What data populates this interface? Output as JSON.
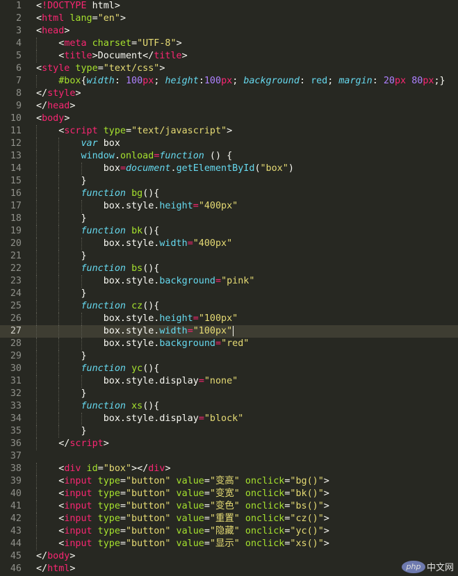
{
  "editor": {
    "active_line": 27,
    "caret_line": 27,
    "theme_colors": {
      "background": "#272822",
      "tag": "#f92672",
      "attribute": "#a6e22e",
      "string": "#e6db74",
      "keyword": "#66d9ef",
      "number": "#ae81ff",
      "text": "#f8f8f2",
      "line_number": "#8f908a"
    },
    "lines": [
      {
        "n": "1",
        "indent": 0,
        "tokens": [
          [
            "plain",
            "<"
          ],
          [
            "tag",
            "!DOCTYPE"
          ],
          [
            "plain",
            " html>"
          ]
        ]
      },
      {
        "n": "2",
        "indent": 0,
        "tokens": [
          [
            "plain",
            "<"
          ],
          [
            "tag",
            "html"
          ],
          [
            "attr",
            " lang"
          ],
          [
            "plain",
            "="
          ],
          [
            "str",
            "\"en\""
          ],
          [
            "plain",
            ">"
          ]
        ]
      },
      {
        "n": "3",
        "indent": 0,
        "tokens": [
          [
            "plain",
            "<"
          ],
          [
            "tag",
            "head"
          ],
          [
            "plain",
            ">"
          ]
        ]
      },
      {
        "n": "4",
        "indent": 1,
        "tokens": [
          [
            "plain",
            "<"
          ],
          [
            "tag",
            "meta"
          ],
          [
            "attr",
            " charset"
          ],
          [
            "plain",
            "="
          ],
          [
            "str",
            "\"UTF-8\""
          ],
          [
            "plain",
            ">"
          ]
        ]
      },
      {
        "n": "5",
        "indent": 1,
        "tokens": [
          [
            "plain",
            "<"
          ],
          [
            "tag",
            "title"
          ],
          [
            "plain",
            ">Document</"
          ],
          [
            "tag",
            "title"
          ],
          [
            "plain",
            ">"
          ]
        ]
      },
      {
        "n": "6",
        "indent": 0,
        "tokens": [
          [
            "plain",
            "<"
          ],
          [
            "tag",
            "style"
          ],
          [
            "attr",
            " type"
          ],
          [
            "plain",
            "="
          ],
          [
            "str",
            "\"text/css\""
          ],
          [
            "plain",
            ">"
          ]
        ]
      },
      {
        "n": "7",
        "indent": 1,
        "tokens": [
          [
            "attr",
            "#box"
          ],
          [
            "plain",
            "{"
          ],
          [
            "cssprop",
            "width"
          ],
          [
            "plain",
            ": "
          ],
          [
            "num",
            "100"
          ],
          [
            "op",
            "px"
          ],
          [
            "plain",
            "; "
          ],
          [
            "cssprop",
            "height"
          ],
          [
            "plain",
            ":"
          ],
          [
            "num",
            "100"
          ],
          [
            "op",
            "px"
          ],
          [
            "plain",
            "; "
          ],
          [
            "cssprop",
            "background"
          ],
          [
            "plain",
            ": "
          ],
          [
            "prop",
            "red"
          ],
          [
            "plain",
            "; "
          ],
          [
            "cssprop",
            "margin"
          ],
          [
            "plain",
            ": "
          ],
          [
            "num",
            "20"
          ],
          [
            "op",
            "px"
          ],
          [
            "plain",
            " "
          ],
          [
            "num",
            "80"
          ],
          [
            "op",
            "px"
          ],
          [
            "plain",
            ";}"
          ]
        ]
      },
      {
        "n": "8",
        "indent": 0,
        "tokens": [
          [
            "plain",
            "</"
          ],
          [
            "tag",
            "style"
          ],
          [
            "plain",
            ">"
          ]
        ]
      },
      {
        "n": "9",
        "indent": 0,
        "tokens": [
          [
            "plain",
            "</"
          ],
          [
            "tag",
            "head"
          ],
          [
            "plain",
            ">"
          ]
        ]
      },
      {
        "n": "10",
        "indent": 0,
        "tokens": [
          [
            "plain",
            "<"
          ],
          [
            "tag",
            "body"
          ],
          [
            "plain",
            ">"
          ]
        ]
      },
      {
        "n": "11",
        "indent": 1,
        "tokens": [
          [
            "plain",
            "<"
          ],
          [
            "tag",
            "script"
          ],
          [
            "attr",
            " type"
          ],
          [
            "plain",
            "="
          ],
          [
            "str",
            "\"text/javascript\""
          ],
          [
            "plain",
            ">"
          ]
        ]
      },
      {
        "n": "12",
        "indent": 2,
        "tokens": [
          [
            "kw",
            "var"
          ],
          [
            "plain",
            " box"
          ]
        ]
      },
      {
        "n": "13",
        "indent": 2,
        "tokens": [
          [
            "prop",
            "window"
          ],
          [
            "plain",
            "."
          ],
          [
            "func",
            "onload"
          ],
          [
            "op",
            "="
          ],
          [
            "kw",
            "function"
          ],
          [
            "plain",
            " () {"
          ]
        ]
      },
      {
        "n": "14",
        "indent": 3,
        "tokens": [
          [
            "plain",
            "box"
          ],
          [
            "op",
            "="
          ],
          [
            "kw",
            "document"
          ],
          [
            "plain",
            "."
          ],
          [
            "prop",
            "getElementById"
          ],
          [
            "plain",
            "("
          ],
          [
            "str",
            "\"box\""
          ],
          [
            "plain",
            ")"
          ]
        ]
      },
      {
        "n": "15",
        "indent": 2,
        "tokens": [
          [
            "plain",
            "}"
          ]
        ]
      },
      {
        "n": "16",
        "indent": 2,
        "tokens": [
          [
            "kw",
            "function"
          ],
          [
            "plain",
            " "
          ],
          [
            "func",
            "bg"
          ],
          [
            "plain",
            "(){"
          ]
        ]
      },
      {
        "n": "17",
        "indent": 3,
        "tokens": [
          [
            "plain",
            "box.style."
          ],
          [
            "prop",
            "height"
          ],
          [
            "op",
            "="
          ],
          [
            "str",
            "\"400px\""
          ]
        ]
      },
      {
        "n": "18",
        "indent": 2,
        "tokens": [
          [
            "plain",
            "}"
          ]
        ]
      },
      {
        "n": "19",
        "indent": 2,
        "tokens": [
          [
            "kw",
            "function"
          ],
          [
            "plain",
            " "
          ],
          [
            "func",
            "bk"
          ],
          [
            "plain",
            "(){"
          ]
        ]
      },
      {
        "n": "20",
        "indent": 3,
        "tokens": [
          [
            "plain",
            "box.style."
          ],
          [
            "prop",
            "width"
          ],
          [
            "op",
            "="
          ],
          [
            "str",
            "\"400px\""
          ]
        ]
      },
      {
        "n": "21",
        "indent": 2,
        "tokens": [
          [
            "plain",
            "}"
          ]
        ]
      },
      {
        "n": "22",
        "indent": 2,
        "tokens": [
          [
            "kw",
            "function"
          ],
          [
            "plain",
            " "
          ],
          [
            "func",
            "bs"
          ],
          [
            "plain",
            "(){"
          ]
        ]
      },
      {
        "n": "23",
        "indent": 3,
        "tokens": [
          [
            "plain",
            "box.style."
          ],
          [
            "prop",
            "background"
          ],
          [
            "op",
            "="
          ],
          [
            "str",
            "\"pink\""
          ]
        ]
      },
      {
        "n": "24",
        "indent": 2,
        "tokens": [
          [
            "plain",
            "}"
          ]
        ]
      },
      {
        "n": "25",
        "indent": 2,
        "tokens": [
          [
            "kw",
            "function"
          ],
          [
            "plain",
            " "
          ],
          [
            "func",
            "cz"
          ],
          [
            "plain",
            "(){"
          ]
        ]
      },
      {
        "n": "26",
        "indent": 3,
        "tokens": [
          [
            "plain",
            "box.style."
          ],
          [
            "prop",
            "height"
          ],
          [
            "op",
            "="
          ],
          [
            "str",
            "\"100px\""
          ]
        ]
      },
      {
        "n": "27",
        "indent": 3,
        "tokens": [
          [
            "plain",
            "box.style."
          ],
          [
            "prop",
            "width"
          ],
          [
            "op",
            "="
          ],
          [
            "str",
            "\"100px\""
          ]
        ]
      },
      {
        "n": "28",
        "indent": 3,
        "tokens": [
          [
            "plain",
            "box.style."
          ],
          [
            "prop",
            "background"
          ],
          [
            "op",
            "="
          ],
          [
            "str",
            "\"red\""
          ]
        ]
      },
      {
        "n": "29",
        "indent": 2,
        "tokens": [
          [
            "plain",
            "}"
          ]
        ]
      },
      {
        "n": "30",
        "indent": 2,
        "tokens": [
          [
            "kw",
            "function"
          ],
          [
            "plain",
            " "
          ],
          [
            "func",
            "yc"
          ],
          [
            "plain",
            "(){"
          ]
        ]
      },
      {
        "n": "31",
        "indent": 3,
        "tokens": [
          [
            "plain",
            "box.style.display"
          ],
          [
            "op",
            "="
          ],
          [
            "str",
            "\"none\""
          ]
        ]
      },
      {
        "n": "32",
        "indent": 2,
        "tokens": [
          [
            "plain",
            "}"
          ]
        ]
      },
      {
        "n": "33",
        "indent": 2,
        "tokens": [
          [
            "kw",
            "function"
          ],
          [
            "plain",
            " "
          ],
          [
            "func",
            "xs"
          ],
          [
            "plain",
            "(){"
          ]
        ]
      },
      {
        "n": "34",
        "indent": 3,
        "tokens": [
          [
            "plain",
            "box.style.display"
          ],
          [
            "op",
            "="
          ],
          [
            "str",
            "\"block\""
          ]
        ]
      },
      {
        "n": "35",
        "indent": 2,
        "tokens": [
          [
            "plain",
            "}"
          ]
        ]
      },
      {
        "n": "36",
        "indent": 1,
        "tokens": [
          [
            "plain",
            "</"
          ],
          [
            "tag",
            "script"
          ],
          [
            "plain",
            ">"
          ]
        ]
      },
      {
        "n": "37",
        "indent": 0,
        "tokens": []
      },
      {
        "n": "38",
        "indent": 1,
        "tokens": [
          [
            "plain",
            "<"
          ],
          [
            "tag",
            "div"
          ],
          [
            "attr",
            " id"
          ],
          [
            "plain",
            "="
          ],
          [
            "str",
            "\"box\""
          ],
          [
            "plain",
            "></"
          ],
          [
            "tag",
            "div"
          ],
          [
            "plain",
            ">"
          ]
        ]
      },
      {
        "n": "39",
        "indent": 1,
        "tokens": [
          [
            "plain",
            "<"
          ],
          [
            "tag",
            "input"
          ],
          [
            "attr",
            " type"
          ],
          [
            "plain",
            "="
          ],
          [
            "str",
            "\"button\""
          ],
          [
            "attr",
            " value"
          ],
          [
            "plain",
            "="
          ],
          [
            "str",
            "\"变高\""
          ],
          [
            "attr",
            " onclick"
          ],
          [
            "plain",
            "="
          ],
          [
            "str",
            "\"bg()\""
          ],
          [
            "plain",
            ">"
          ]
        ]
      },
      {
        "n": "40",
        "indent": 1,
        "tokens": [
          [
            "plain",
            "<"
          ],
          [
            "tag",
            "input"
          ],
          [
            "attr",
            " type"
          ],
          [
            "plain",
            "="
          ],
          [
            "str",
            "\"button\""
          ],
          [
            "attr",
            " value"
          ],
          [
            "plain",
            "="
          ],
          [
            "str",
            "\"变宽\""
          ],
          [
            "attr",
            " onclick"
          ],
          [
            "plain",
            "="
          ],
          [
            "str",
            "\"bk()\""
          ],
          [
            "plain",
            ">"
          ]
        ]
      },
      {
        "n": "41",
        "indent": 1,
        "tokens": [
          [
            "plain",
            "<"
          ],
          [
            "tag",
            "input"
          ],
          [
            "attr",
            " type"
          ],
          [
            "plain",
            "="
          ],
          [
            "str",
            "\"button\""
          ],
          [
            "attr",
            " value"
          ],
          [
            "plain",
            "="
          ],
          [
            "str",
            "\"变色\""
          ],
          [
            "attr",
            " onclick"
          ],
          [
            "plain",
            "="
          ],
          [
            "str",
            "\"bs()\""
          ],
          [
            "plain",
            ">"
          ]
        ]
      },
      {
        "n": "42",
        "indent": 1,
        "tokens": [
          [
            "plain",
            "<"
          ],
          [
            "tag",
            "input"
          ],
          [
            "attr",
            " type"
          ],
          [
            "plain",
            "="
          ],
          [
            "str",
            "\"button\""
          ],
          [
            "attr",
            " value"
          ],
          [
            "plain",
            "="
          ],
          [
            "str",
            "\"重置\""
          ],
          [
            "attr",
            " onclick"
          ],
          [
            "plain",
            "="
          ],
          [
            "str",
            "\"cz()\""
          ],
          [
            "plain",
            ">"
          ]
        ]
      },
      {
        "n": "43",
        "indent": 1,
        "tokens": [
          [
            "plain",
            "<"
          ],
          [
            "tag",
            "input"
          ],
          [
            "attr",
            " type"
          ],
          [
            "plain",
            "="
          ],
          [
            "str",
            "\"button\""
          ],
          [
            "attr",
            " value"
          ],
          [
            "plain",
            "="
          ],
          [
            "str",
            "\"隐藏\""
          ],
          [
            "attr",
            " onclick"
          ],
          [
            "plain",
            "="
          ],
          [
            "str",
            "\"yc()\""
          ],
          [
            "plain",
            ">"
          ]
        ]
      },
      {
        "n": "44",
        "indent": 1,
        "tokens": [
          [
            "plain",
            "<"
          ],
          [
            "tag",
            "input"
          ],
          [
            "attr",
            " type"
          ],
          [
            "plain",
            "="
          ],
          [
            "str",
            "\"button\""
          ],
          [
            "attr",
            " value"
          ],
          [
            "plain",
            "="
          ],
          [
            "str",
            "\"显示\""
          ],
          [
            "attr",
            " onclick"
          ],
          [
            "plain",
            "="
          ],
          [
            "str",
            "\"xs()\""
          ],
          [
            "plain",
            ">"
          ]
        ]
      },
      {
        "n": "45",
        "indent": 0,
        "tokens": [
          [
            "plain",
            "</"
          ],
          [
            "tag",
            "body"
          ],
          [
            "plain",
            ">"
          ]
        ]
      },
      {
        "n": "46",
        "indent": 0,
        "tokens": [
          [
            "plain",
            "</"
          ],
          [
            "tag",
            "html"
          ],
          [
            "plain",
            ">"
          ]
        ]
      }
    ]
  },
  "watermark": {
    "logo_text": "php",
    "site_text": "中文网"
  }
}
